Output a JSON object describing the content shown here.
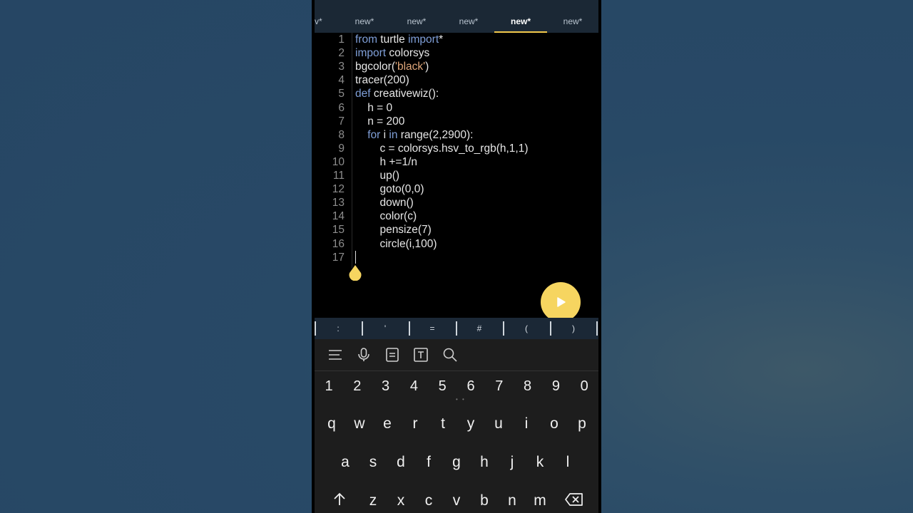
{
  "tabs": {
    "cut_label": "v*",
    "items": [
      {
        "label": "new*",
        "active": false
      },
      {
        "label": "new*",
        "active": false
      },
      {
        "label": "new*",
        "active": false
      },
      {
        "label": "new*",
        "active": true
      },
      {
        "label": "new*",
        "active": false
      }
    ]
  },
  "editor": {
    "line_numbers": [
      "1",
      "2",
      "3",
      "4",
      "5",
      "6",
      "7",
      "8",
      "9",
      "10",
      "11",
      "12",
      "13",
      "14",
      "15",
      "16",
      "17"
    ],
    "lines": [
      [
        {
          "t": "from",
          "k": "kw"
        },
        {
          "t": " turtle "
        },
        {
          "t": "import",
          "k": "kw"
        },
        {
          "t": "*"
        }
      ],
      [
        {
          "t": "import",
          "k": "kw"
        },
        {
          "t": " colorsys"
        }
      ],
      [
        {
          "t": "bgcolor("
        },
        {
          "t": "'black'",
          "k": "str"
        },
        {
          "t": ")"
        }
      ],
      [
        {
          "t": "tracer(200)"
        }
      ],
      [
        {
          "t": "def",
          "k": "kw"
        },
        {
          "t": " creativewiz():"
        }
      ],
      [
        {
          "t": "    h = 0"
        }
      ],
      [
        {
          "t": "    n = 200"
        }
      ],
      [
        {
          "t": "    "
        },
        {
          "t": "for",
          "k": "kw"
        },
        {
          "t": " i "
        },
        {
          "t": "in",
          "k": "kw"
        },
        {
          "t": " range(2,2900):"
        }
      ],
      [
        {
          "t": "        c = colorsys.hsv_to_rgb(h,1,1)"
        }
      ],
      [
        {
          "t": "        h +=1/n"
        }
      ],
      [
        {
          "t": "        up()"
        }
      ],
      [
        {
          "t": "        goto(0,0)"
        }
      ],
      [
        {
          "t": "        down()"
        }
      ],
      [
        {
          "t": "        color(c)"
        }
      ],
      [
        {
          "t": "        pensize(7)"
        }
      ],
      [
        {
          "t": "        circle(i,100)"
        }
      ],
      [
        {
          "t": ""
        }
      ]
    ]
  },
  "symbols": [
    ":",
    "'",
    "=",
    "#",
    "(",
    ")"
  ],
  "keyboard": {
    "toolbar_icons": [
      "menu-icon",
      "microphone-icon",
      "clipboard-icon",
      "text-format-icon",
      "search-icon"
    ],
    "numbers": [
      "1",
      "2",
      "3",
      "4",
      "5",
      "6",
      "7",
      "8",
      "9",
      "0"
    ],
    "row1": [
      "q",
      "w",
      "e",
      "r",
      "t",
      "y",
      "u",
      "i",
      "o",
      "p"
    ],
    "row2": [
      "a",
      "s",
      "d",
      "f",
      "g",
      "h",
      "j",
      "k",
      "l"
    ],
    "row3": [
      "z",
      "x",
      "c",
      "v",
      "b",
      "n",
      "m"
    ]
  },
  "colors": {
    "accent": "#f6d560",
    "keyword": "#7f9fd8",
    "string": "#e0a77a",
    "tabbar": "#1b2835"
  }
}
